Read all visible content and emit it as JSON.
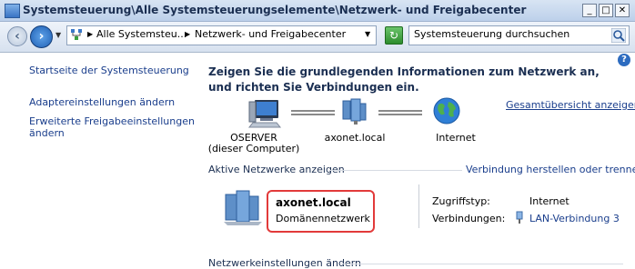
{
  "window": {
    "title": "Systemsteuerung\\Alle Systemsteuerungselemente\\Netzwerk- und Freigabecenter",
    "minimize_label": "_",
    "maximize_label": "□",
    "close_label": "✕"
  },
  "addressbar": {
    "crumbs": [
      "Alle Systemsteu...",
      "Netzwerk- und Freigabecenter"
    ],
    "search_placeholder": "Systemsteuerung durchsuchen"
  },
  "sidebar": {
    "items": [
      {
        "label": "Startseite der Systemsteuerung"
      },
      {
        "label": "Adaptereinstellungen ändern"
      },
      {
        "label": "Erweiterte Freigabeeinstellungen",
        "label2": "ändern"
      }
    ]
  },
  "main": {
    "heading": "Zeigen Sie die grundlegenden Informationen zum Netzwerk an, und richten Sie Verbindungen ein.",
    "full_map_link": "Gesamtübersicht anzeigen",
    "map": {
      "computer_name": "OSERVER",
      "computer_sub": "(dieser Computer)",
      "network_name": "axonet.local",
      "internet_label": "Internet"
    },
    "active_networks_label": "Aktive Netzwerke anzeigen",
    "connect_link": "Verbindung herstellen oder trennen",
    "network": {
      "name": "axonet.local",
      "type": "Domänennetzwerk",
      "access_type_label": "Zugriffstyp:",
      "access_type_value": "Internet",
      "connections_label": "Verbindungen:",
      "connections_value": "LAN-Verbindung 3"
    },
    "change_settings_label": "Netzwerkeinstellungen ändern",
    "help_label": "?"
  }
}
